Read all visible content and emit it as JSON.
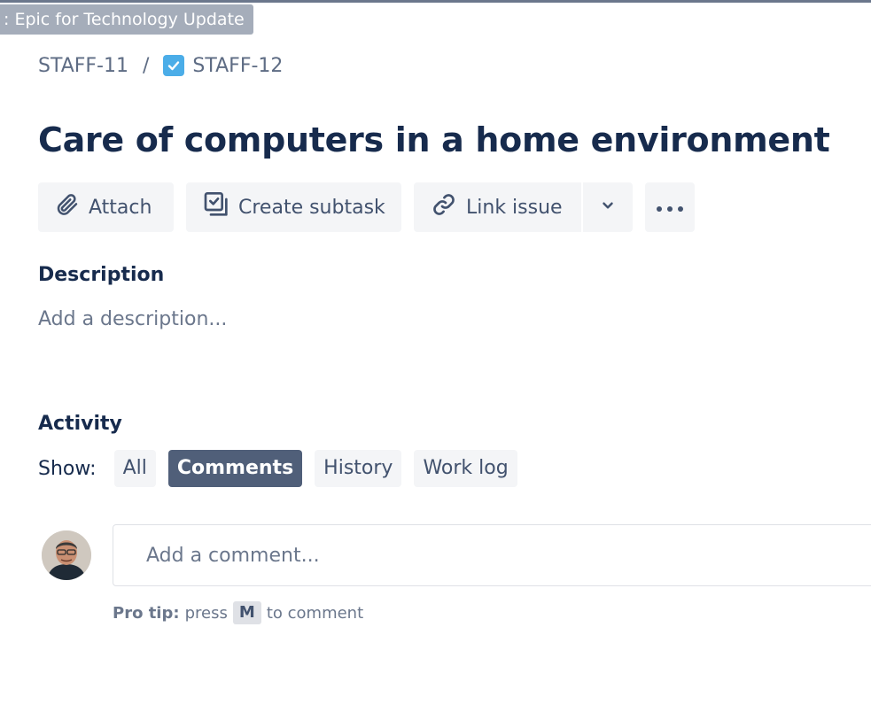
{
  "epic_tag": ": Epic for Technology Update",
  "breadcrumb": {
    "parent": "STAFF-11",
    "separator": "/",
    "current": "STAFF-12"
  },
  "issue": {
    "title": "Care of computers in a home environment"
  },
  "actions": {
    "attach": "Attach",
    "create_subtask": "Create subtask",
    "link_issue": "Link issue",
    "chevron_icon": "chevron-down",
    "more_icon": "more-horizontal"
  },
  "description": {
    "heading": "Description",
    "placeholder": "Add a description..."
  },
  "activity": {
    "heading": "Activity",
    "show_label": "Show:",
    "filters": [
      "All",
      "Comments",
      "History",
      "Work log"
    ],
    "active_filter": "Comments"
  },
  "comment": {
    "placeholder": "Add a comment...",
    "pro_tip_label": "Pro tip:",
    "pro_tip_before": "press",
    "pro_tip_key": "M",
    "pro_tip_after": "to comment"
  },
  "colors": {
    "text_primary": "#172b4d",
    "text_subtle": "#6b778c",
    "button_bg": "#f4f5f7",
    "active_pill": "#505f79",
    "issue_type_blue": "#4bade8"
  }
}
